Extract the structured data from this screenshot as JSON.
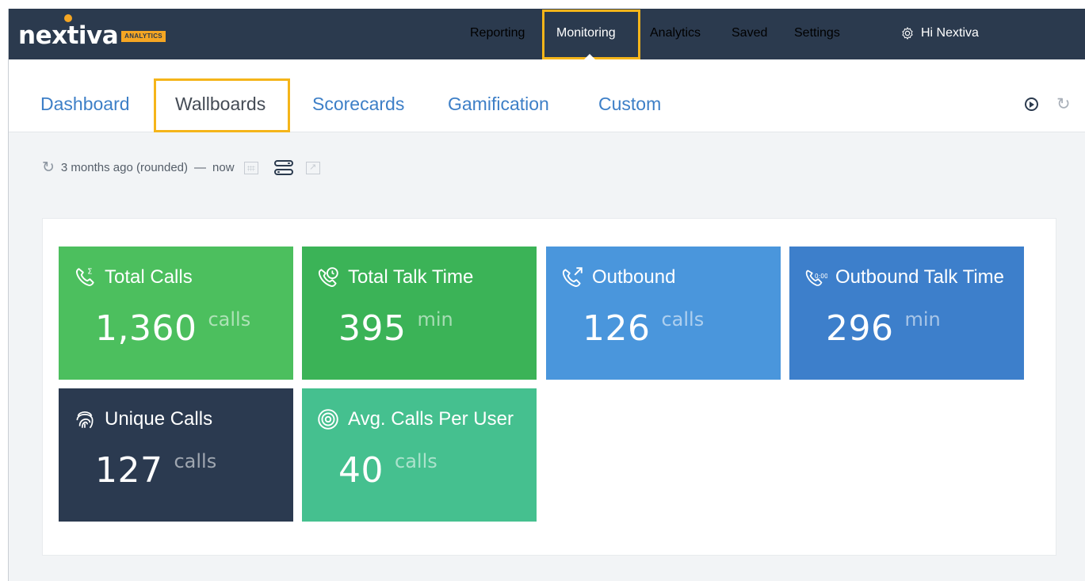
{
  "app": {
    "logo_text": "nextiva",
    "logo_badge": "ANALYTICS"
  },
  "topnav": {
    "items": [
      {
        "label": "Reporting",
        "active": false
      },
      {
        "label": "Monitoring",
        "active": true
      },
      {
        "label": "Analytics",
        "active": false
      },
      {
        "label": "Saved",
        "active": false
      },
      {
        "label": "Settings",
        "active": false
      }
    ],
    "user_greeting": "Hi Nextiva"
  },
  "subnav": {
    "tabs": [
      {
        "label": "Dashboard",
        "active": false
      },
      {
        "label": "Wallboards",
        "active": true
      },
      {
        "label": "Scorecards",
        "active": false
      },
      {
        "label": "Gamification",
        "active": false
      },
      {
        "label": "Custom",
        "active": false
      }
    ]
  },
  "filter": {
    "range_start": "3 months ago (rounded)",
    "separator": "—",
    "range_end": "now"
  },
  "tiles": [
    {
      "title": "Total Calls",
      "value": "1,360",
      "unit": "calls",
      "color": "#4cbf5e",
      "icon": "phone-sum-icon"
    },
    {
      "title": "Total Talk Time",
      "value": "395",
      "unit": "min",
      "color": "#3bb357",
      "icon": "phone-clock-icon"
    },
    {
      "title": "Outbound",
      "value": "126",
      "unit": "calls",
      "color": "#4a96dc",
      "icon": "phone-outbound-icon"
    },
    {
      "title": "Outbound Talk Time",
      "value": "296",
      "unit": "min",
      "color": "#3d7fcb",
      "icon": "phone-timer-icon"
    },
    {
      "title": "Unique Calls",
      "value": "127",
      "unit": "calls",
      "color": "#2b3a50",
      "icon": "fingerprint-icon"
    },
    {
      "title": "Avg. Calls Per User",
      "value": "40",
      "unit": "calls",
      "color": "#45c08f",
      "icon": "target-icon"
    }
  ],
  "colors": {
    "topbar": "#2b3a4e",
    "accent_highlight": "#f5b51a",
    "link_blue": "#3d7fc7"
  }
}
